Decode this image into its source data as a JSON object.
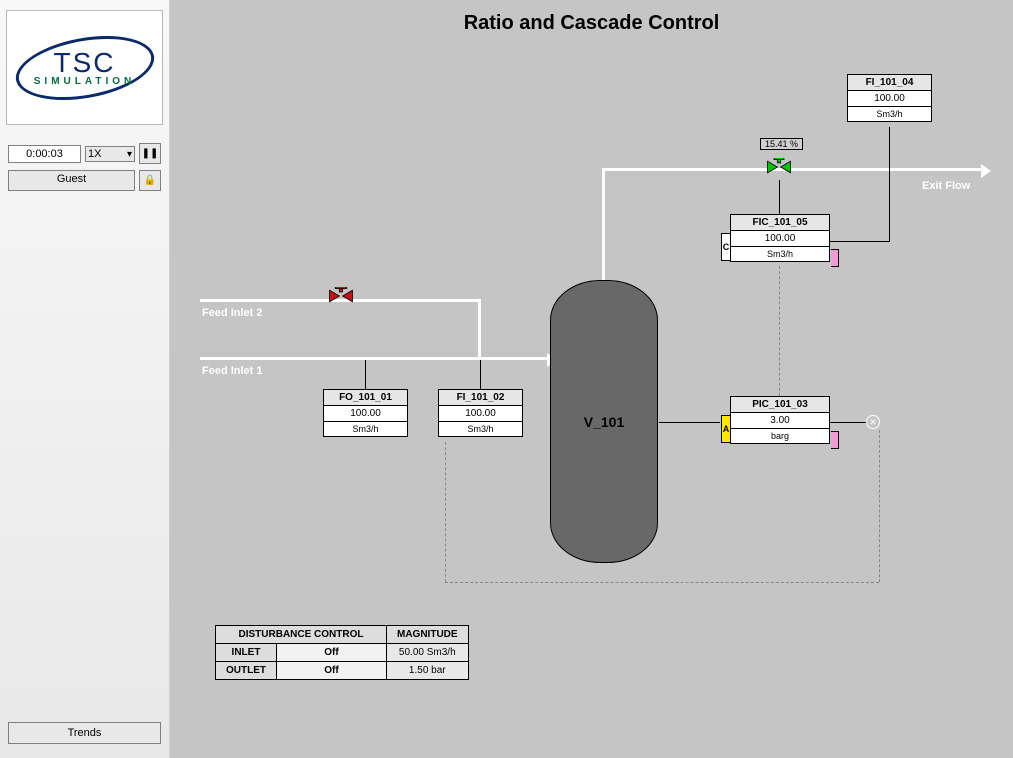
{
  "sidebar": {
    "logo_text": "TSC",
    "logo_sub": "SIMULATION",
    "clock": "0:00:03",
    "speed": "1X",
    "pause_icon": "❚❚",
    "user": "Guest",
    "lock_icon": "🔒",
    "trends": "Trends"
  },
  "title": "Ratio and Cascade Control",
  "vessel": {
    "label": "V_101"
  },
  "pipes": {
    "feed1": "Feed Inlet 1",
    "feed2": "Feed Inlet 2",
    "exit": "Exit Flow"
  },
  "valves": {
    "red": {
      "state": "closed"
    },
    "green": {
      "state": "open",
      "pct": "15.41 %"
    }
  },
  "tags": {
    "FO_101_01": {
      "name": "FO_101_01",
      "value": "100.00",
      "unit": "Sm3/h"
    },
    "FI_101_02": {
      "name": "FI_101_02",
      "value": "100.00",
      "unit": "Sm3/h"
    },
    "PIC_101_03": {
      "name": "PIC_101_03",
      "value": "3.00",
      "unit": "barg",
      "mode": "A"
    },
    "FI_101_04": {
      "name": "FI_101_04",
      "value": "100.00",
      "unit": "Sm3/h"
    },
    "FIC_101_05": {
      "name": "FIC_101_05",
      "value": "100.00",
      "unit": "Sm3/h",
      "mode": "C"
    }
  },
  "disturbance": {
    "header_ctrl": "DISTURBANCE CONTROL",
    "header_mag": "MAGNITUDE",
    "rows": [
      {
        "label": "INLET",
        "state": "Off",
        "mag": "50.00 Sm3/h"
      },
      {
        "label": "OUTLET",
        "state": "Off",
        "mag": "1.50 bar"
      }
    ]
  }
}
